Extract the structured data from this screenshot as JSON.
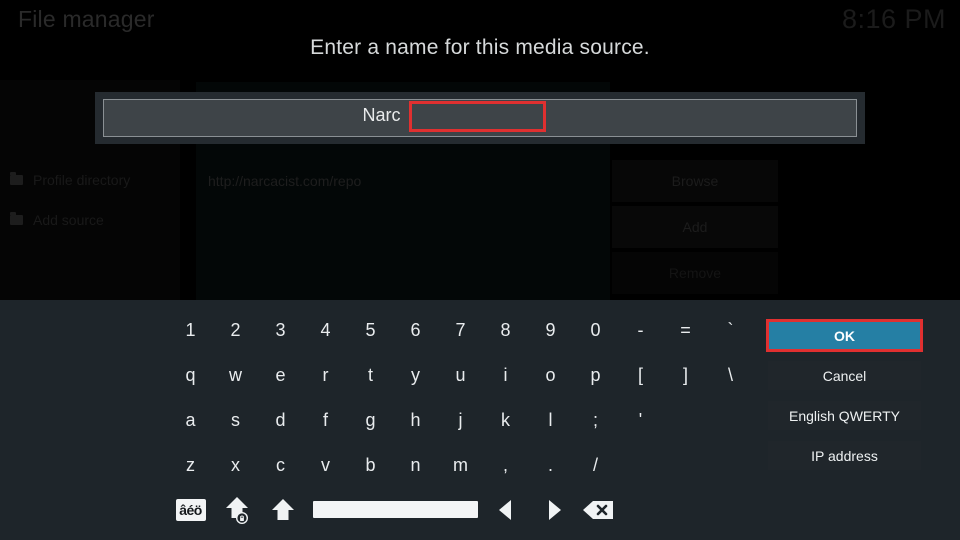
{
  "background": {
    "app_title": "File manager",
    "clock": "8:16 PM",
    "left_items": [
      {
        "label": "Profile directory",
        "icon": "folder-icon"
      },
      {
        "label": "Add source",
        "icon": "folder-icon"
      }
    ],
    "source_url": "http://narcacist.com/repo",
    "buttons": [
      {
        "label": "Browse"
      },
      {
        "label": "Add"
      },
      {
        "label": "Remove"
      }
    ]
  },
  "dialog": {
    "title": "Enter a name for this media source.",
    "input_value": "Narc",
    "input_placeholder": ""
  },
  "keyboard": {
    "rows": [
      [
        "1",
        "2",
        "3",
        "4",
        "5",
        "6",
        "7",
        "8",
        "9",
        "0",
        "-",
        "=",
        "`"
      ],
      [
        "q",
        "w",
        "e",
        "r",
        "t",
        "y",
        "u",
        "i",
        "o",
        "p",
        "[",
        "]",
        "\\"
      ],
      [
        "a",
        "s",
        "d",
        "f",
        "g",
        "h",
        "j",
        "k",
        "l",
        ";",
        "'"
      ],
      [
        "z",
        "x",
        "c",
        "v",
        "b",
        "n",
        "m",
        ",",
        ".",
        "/"
      ]
    ],
    "function_row": [
      {
        "name": "accent-key",
        "label": "âéö"
      },
      {
        "name": "caps-lock-key",
        "label": ""
      },
      {
        "name": "shift-key",
        "label": ""
      },
      {
        "name": "space-key",
        "label": ""
      },
      {
        "name": "cursor-left-key",
        "label": ""
      },
      {
        "name": "cursor-right-key",
        "label": ""
      },
      {
        "name": "backspace-key",
        "label": ""
      }
    ]
  },
  "actions": [
    {
      "label": "OK",
      "selected": true
    },
    {
      "label": "Cancel",
      "selected": false
    },
    {
      "label": "English QWERTY",
      "selected": false
    },
    {
      "label": "IP address",
      "selected": false
    }
  ],
  "colors": {
    "accent": "#257fa4",
    "highlight_border": "#e03030",
    "keyboard_bg": "#1e252a",
    "field_bg": "#3e4448"
  }
}
